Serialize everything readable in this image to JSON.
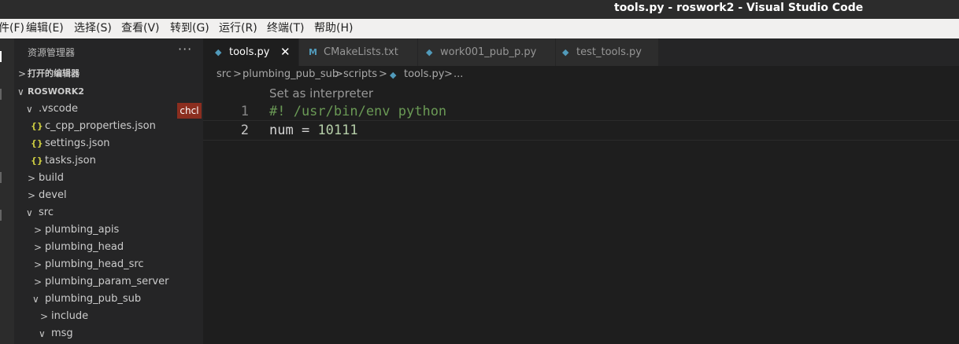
{
  "window": {
    "title": "tools.py - roswork2 - Visual Studio Code"
  },
  "menubar": [
    "件(F)",
    "编辑(E)",
    "选择(S)",
    "查看(V)",
    "转到(G)",
    "运行(R)",
    "终端(T)",
    "帮助(H)"
  ],
  "explorer": {
    "title": "资源管理器",
    "more": "···",
    "open_editors": "打开的编辑器",
    "workspace": "ROSWORK2",
    "badge": "chcl",
    "items": [
      {
        "label": ".vscode",
        "chev": "∨"
      },
      {
        "label": "c_cpp_properties.json",
        "icon": "{}"
      },
      {
        "label": "settings.json",
        "icon": "{}"
      },
      {
        "label": "tasks.json",
        "icon": "{}"
      },
      {
        "label": "build",
        "chev": ">"
      },
      {
        "label": "devel",
        "chev": ">"
      },
      {
        "label": "src",
        "chev": "∨"
      },
      {
        "label": "plumbing_apis",
        "chev": ">"
      },
      {
        "label": "plumbing_head",
        "chev": ">"
      },
      {
        "label": "plumbing_head_src",
        "chev": ">"
      },
      {
        "label": "plumbing_param_server",
        "chev": ">"
      },
      {
        "label": "plumbing_pub_sub",
        "chev": "∨"
      },
      {
        "label": "include",
        "chev": ">"
      },
      {
        "label": "msg",
        "chev": "∨"
      }
    ]
  },
  "tabs": [
    {
      "label": "tools.py",
      "icon": "python-icon",
      "active": true,
      "close": "✕"
    },
    {
      "label": "CMakeLists.txt",
      "icon": "cmake-icon",
      "glyph": "M"
    },
    {
      "label": "work001_pub_p.py",
      "icon": "python-icon"
    },
    {
      "label": "test_tools.py",
      "icon": "python-icon"
    }
  ],
  "breadcrumb": [
    "src",
    ">",
    "plumbing_pub_sub",
    ">",
    "scripts",
    ">",
    "tools.py",
    ">",
    "..."
  ],
  "editor": {
    "codelens": "Set as interpreter",
    "lines": [
      {
        "number": "1",
        "text": "#! /usr/bin/env python"
      },
      {
        "number": "2",
        "var": "num",
        "op": " = ",
        "value": "10111"
      }
    ]
  },
  "colors": {
    "accent": "#519aba",
    "badge": "#8b2e1f",
    "comment": "#6a9955",
    "number": "#b5cea8"
  }
}
